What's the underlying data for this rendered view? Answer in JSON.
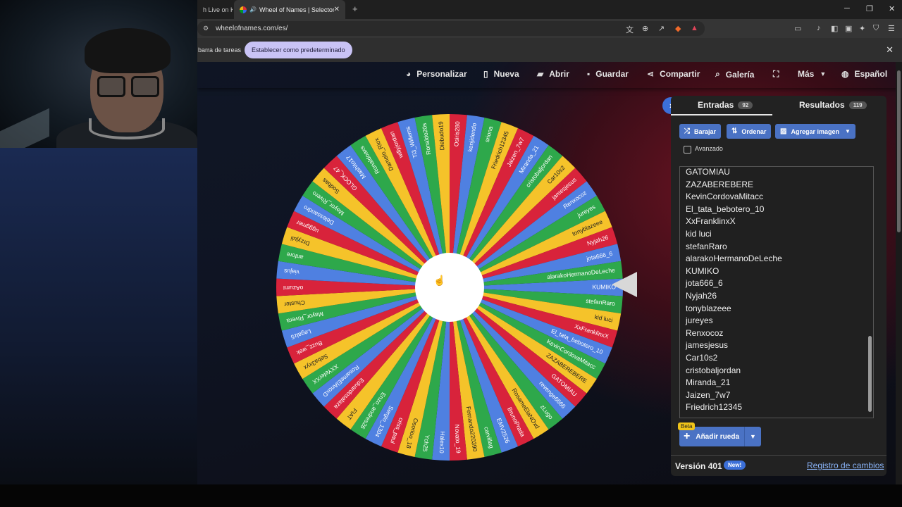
{
  "browser": {
    "tabs": [
      {
        "title": "h Live on K"
      },
      {
        "title": "Wheel of Names | Selector de"
      }
    ],
    "url": "wheelofnames.com/es/",
    "infobar": {
      "text": "barra de tareas",
      "button": "Establecer como predeterminado"
    }
  },
  "menu": {
    "items": [
      {
        "icon": "palette-icon",
        "label": "Personalizar"
      },
      {
        "icon": "file-icon",
        "label": "Nueva"
      },
      {
        "icon": "folder-icon",
        "label": "Abrir"
      },
      {
        "icon": "save-icon",
        "label": "Guardar"
      },
      {
        "icon": "share-icon",
        "label": "Compartir"
      },
      {
        "icon": "search-icon",
        "label": "Galería"
      },
      {
        "icon": "fullscreen-icon",
        "label": ""
      },
      {
        "icon": "chevron-down-icon",
        "label": "Más"
      },
      {
        "icon": "globe-icon",
        "label": "Español"
      }
    ]
  },
  "wheel": {
    "colors": [
      "#4f80e1",
      "#2ea84b",
      "#f5c32a",
      "#d8233b"
    ],
    "entries": [
      "KUMIKO",
      "stefanRaro",
      "kid luci",
      "XxFranklinxX",
      "El_tata_bebotero_10",
      "KevinCordovaMitacc",
      "ZAZABEREBERE",
      "GATOMIAU",
      "revenge6666",
      "zLugo",
      "RosameElaNOxd",
      "BrunoPrada",
      "EMV2526",
      "carvillag",
      "Fernando220390",
      "Novato_19",
      "Halex10",
      "Ych25",
      "Osorioo_18",
      "criss_paul",
      "Sergio_1304",
      "Enzo_andres26",
      "FIAT",
      "Eduardosalaza",
      "RosameElAnoxD",
      "XXYeferXX",
      "Seba3xyx",
      "Buzz_wek",
      "Legalz5",
      "Mayor_Rivera",
      "Chuster",
      "oAzumi",
      "viajus",
      "anfore",
      "Drzyjuli",
      "ugggmer",
      "Delessandro",
      "Mayor_Rivero",
      "Sodbas",
      "GLOCK_47",
      "Mashito17",
      "Ronaldoaxs",
      "Damelo_Riox",
      "willyjordan",
      "Ti3_Willems",
      "Ronaldo20s",
      "Diebudo19",
      "Osiris280",
      "kenjidendo",
      "sriona",
      "Friedrich12345",
      "Jaizen_7w7",
      "Miranda_21",
      "cristobaljordan",
      "Car10s2",
      "jamesjesus",
      "Renxocoz",
      "jureyes",
      "tonyblazeee",
      "Nyjah26",
      "jota666_6",
      "alarakoHermanoDeLeche"
    ]
  },
  "panel": {
    "tabs": [
      {
        "label": "Entradas",
        "count": "92"
      },
      {
        "label": "Resultados",
        "count": "119"
      }
    ],
    "buttons": {
      "shuffle": "Barajar",
      "sort": "Ordenar",
      "add_image": "Agregar imagen"
    },
    "advanced_label": "Avanzado",
    "entries": [
      "GATOMIAU",
      "ZAZABEREBERE",
      "KevinCordovaMitacc",
      "El_tata_bebotero_10",
      "XxFranklinxX",
      "kid luci",
      "stefanRaro",
      "alarakoHermanoDeLeche",
      "KUMIKO",
      "jota666_6",
      "Nyjah26",
      "tonyblazeee",
      "jureyes",
      "Renxocoz",
      "jamesjesus",
      "Car10s2",
      "cristobaljordan",
      "Miranda_21",
      "Jaizen_7w7",
      "Friedrich12345"
    ],
    "beta": "Beta",
    "add_wheel": "Añadir rueda",
    "version": "Versión 401",
    "new_badge": "New!",
    "changelog": "Registro de cambios"
  }
}
